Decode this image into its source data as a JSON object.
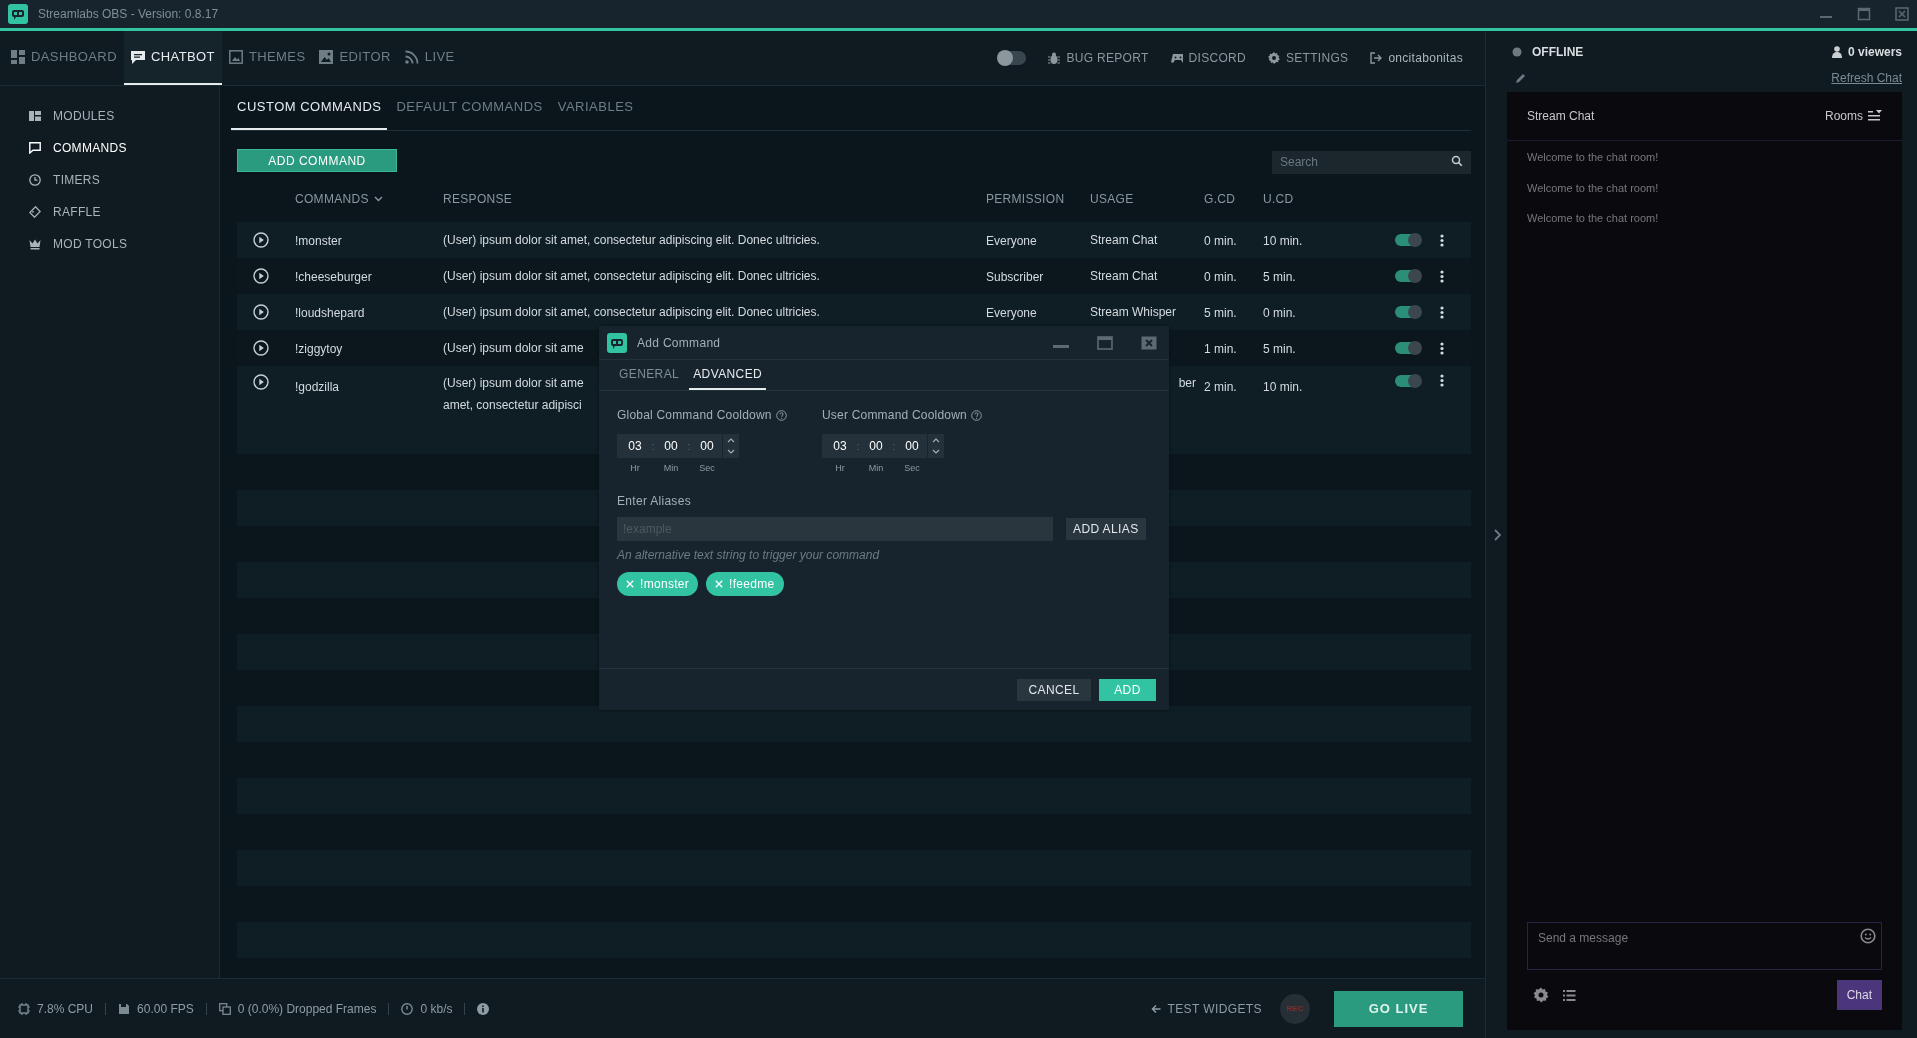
{
  "title_bar": {
    "title": "Streamlabs OBS - Version: 0.8.17"
  },
  "top_nav": {
    "tabs": [
      {
        "label": "DASHBOARD",
        "selected": false
      },
      {
        "label": "CHATBOT",
        "selected": true
      },
      {
        "label": "THEMES",
        "selected": false
      },
      {
        "label": "EDITOR",
        "selected": false
      },
      {
        "label": "LIVE",
        "selected": false
      }
    ],
    "night_mode": {
      "on": false
    },
    "actions": [
      "BUG REPORT",
      "DISCORD",
      "SETTINGS",
      "oncitabonitas"
    ]
  },
  "sidebar": {
    "items": [
      {
        "label": "MODULES",
        "selected": false
      },
      {
        "label": "COMMANDS",
        "selected": true
      },
      {
        "label": "TIMERS",
        "selected": false
      },
      {
        "label": "RAFFLE",
        "selected": false
      },
      {
        "label": "MOD TOOLS",
        "selected": false
      }
    ]
  },
  "sub_tabs": [
    {
      "label": "CUSTOM COMMANDS",
      "selected": true
    },
    {
      "label": "DEFAULT COMMANDS",
      "selected": false
    },
    {
      "label": "VARIABLES",
      "selected": false
    }
  ],
  "add_command_button": "ADD COMMAND",
  "search": {
    "placeholder": "Search"
  },
  "table": {
    "columns": [
      "COMMANDS",
      "RESPONSE",
      "PERMISSION",
      "USAGE",
      "G.CD",
      "U.CD"
    ],
    "rows": [
      {
        "command": "!monster",
        "response": [
          "(User) ipsum dolor sit amet, consectetur adipiscing elit. Donec ultricies."
        ],
        "permission": "Everyone",
        "usage": "Stream Chat",
        "gcd": "0 min.",
        "ucd": "10 min.",
        "enabled": true
      },
      {
        "command": "!cheeseburger",
        "response": [
          "(User) ipsum dolor sit amet, consectetur adipiscing elit. Donec ultricies."
        ],
        "permission": "Subscriber",
        "usage": "Stream Chat",
        "gcd": "0 min.",
        "ucd": "5 min.",
        "enabled": true
      },
      {
        "command": "!loudshepard",
        "response": [
          "(User) ipsum dolor sit amet, consectetur adipiscing elit. Donec ultricies."
        ],
        "permission": "Everyone",
        "usage": "Stream Whisper",
        "gcd": "5 min.",
        "ucd": "0 min.",
        "enabled": true
      },
      {
        "command": "!ziggytoy",
        "response": [
          "(User) ipsum dolor sit ame"
        ],
        "gcd": "1 min.",
        "ucd": "5 min.",
        "enabled": true
      },
      {
        "command": "!godzilla",
        "response": [
          "(User) ipsum dolor sit ame",
          "amet, consectetur adipisci"
        ],
        "permission_tail": "ber",
        "gcd": "2 min.",
        "ucd": "10 min.",
        "enabled": true
      }
    ]
  },
  "dialog": {
    "title": "Add Command",
    "tabs": [
      {
        "label": "GENERAL",
        "selected": false
      },
      {
        "label": "ADVANCED",
        "selected": true
      }
    ],
    "cooldowns": [
      {
        "label": "Global Command Cooldown",
        "values": [
          "03",
          "00",
          "00"
        ],
        "separators": [
          ":",
          ":"
        ],
        "units": [
          "Hr",
          "Min",
          "Sec"
        ]
      },
      {
        "label": "User Command Cooldown",
        "values": [
          "03",
          "00",
          "00"
        ],
        "separators": [
          ":",
          ":"
        ],
        "units": [
          "Hr",
          "Min",
          "Sec"
        ]
      }
    ],
    "aliases_label": "Enter Aliases",
    "alias_placeholder": "!example",
    "add_alias_button": "ADD ALIAS",
    "alias_hint": "An alternative text string to trigger your command",
    "aliases": [
      "!monster",
      "!feedme"
    ],
    "buttons": [
      "CANCEL",
      "ADD"
    ]
  },
  "status_bar": {
    "stats": [
      "7.8% CPU",
      "60.00 FPS",
      "0 (0.0%) Dropped Frames",
      "0 kb/s"
    ],
    "test_widgets": "TEST WIDGETS",
    "rec": "REC",
    "go_live": "GO LIVE"
  },
  "chat": {
    "status": "OFFLINE",
    "viewers": "0 viewers",
    "refresh": "Refresh Chat",
    "header": "Stream Chat",
    "rooms": "Rooms",
    "messages": [
      "Welcome to the chat room!",
      "Welcome to the chat room!",
      "Welcome to the chat room!"
    ],
    "input_placeholder": "Send a message",
    "send": "Chat"
  }
}
